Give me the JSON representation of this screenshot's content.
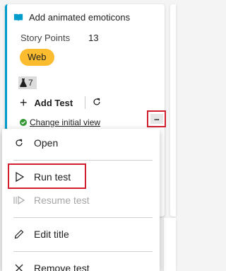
{
  "card": {
    "title": "Add animated emoticons",
    "story_points_label": "Story Points",
    "story_points_value": "13",
    "tag": "Web",
    "test_count": "7",
    "add_test_label": "Add Test",
    "status_link": "Change initial view",
    "more_glyph": "...",
    "accent_color": "#009ccc",
    "tag_color": "#fbbd2f"
  },
  "menu": {
    "items": [
      {
        "label": "Open",
        "icon": "refresh-icon",
        "enabled": true
      },
      {
        "label": "Run test",
        "icon": "play-icon",
        "enabled": true
      },
      {
        "label": "Resume test",
        "icon": "resume-icon",
        "enabled": false
      },
      {
        "label": "Edit title",
        "icon": "pencil-icon",
        "enabled": true
      },
      {
        "label": "Remove test",
        "icon": "close-icon",
        "enabled": true
      }
    ]
  },
  "colors": {
    "highlight_border": "#d21f2f"
  }
}
